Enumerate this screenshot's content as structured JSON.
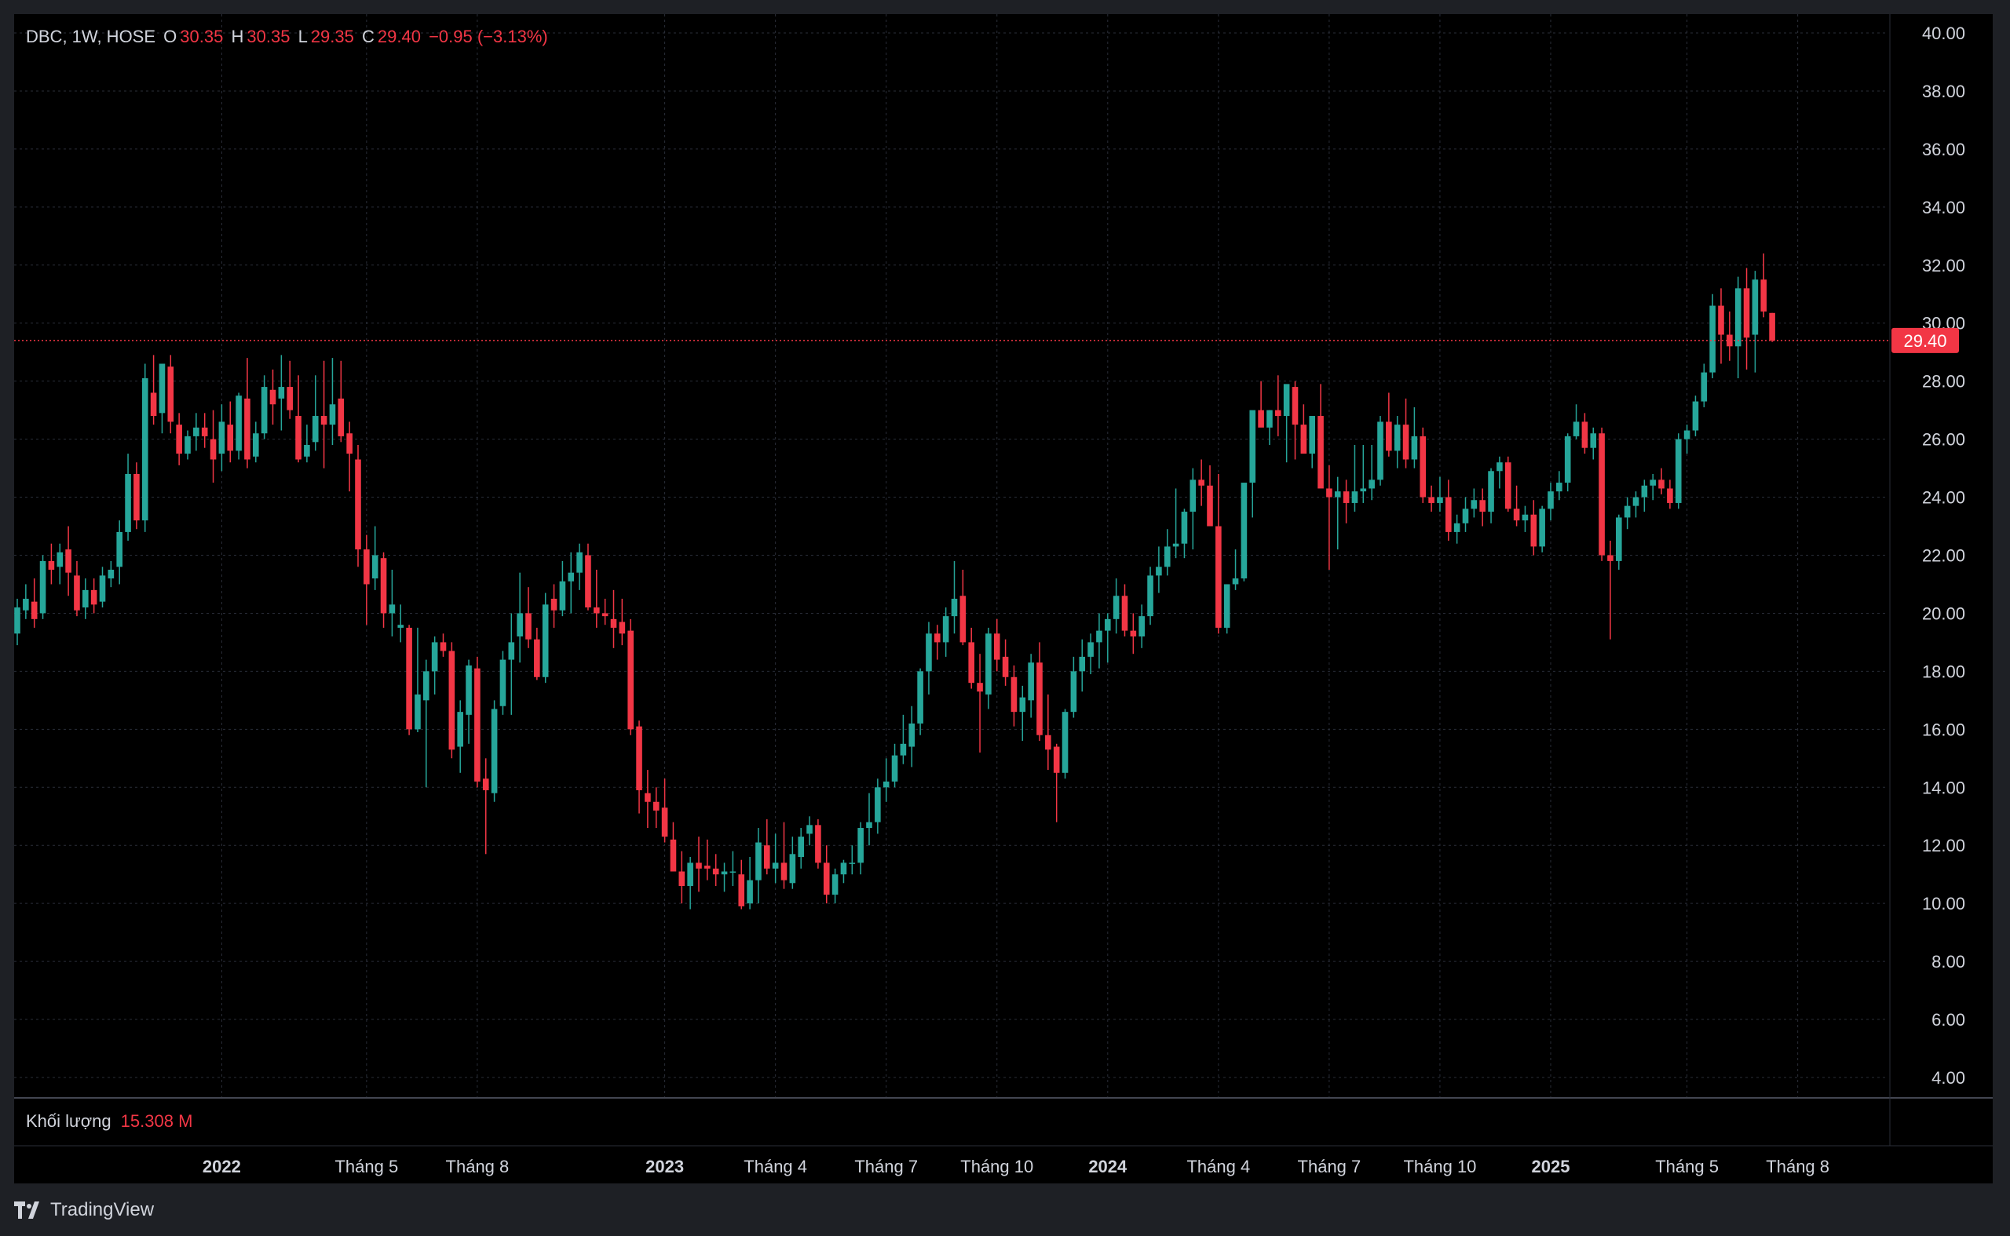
{
  "legend": {
    "symbol": "DBC, 1W, HOSE",
    "o_label": "O",
    "o_value": "30.35",
    "h_label": "H",
    "h_value": "30.35",
    "l_label": "L",
    "l_value": "29.35",
    "c_label": "C",
    "c_value": "29.40",
    "change": "−0.95 (−3.13%)"
  },
  "volume": {
    "label": "Khối lượng",
    "value": "15.308 M"
  },
  "brand": {
    "name": "TradingView"
  },
  "colors": {
    "up": "#26a69a",
    "down": "#f23645",
    "grid": "#2a2e39",
    "text": "#d1d4dc",
    "bg": "#000000"
  },
  "chart_data": {
    "type": "candlestick",
    "interval": "1W",
    "ylim": [
      3,
      41
    ],
    "y_ticks": [
      "40.00",
      "38.00",
      "36.00",
      "34.00",
      "32.00",
      "30.00",
      "28.00",
      "26.00",
      "24.00",
      "22.00",
      "20.00",
      "18.00",
      "16.00",
      "14.00",
      "12.00",
      "10.00",
      "8.00",
      "6.00",
      "4.00"
    ],
    "x_ticks": [
      {
        "label": "2022",
        "bold": true,
        "week": 24
      },
      {
        "label": "Tháng 5",
        "bold": false,
        "week": 41
      },
      {
        "label": "Tháng 8",
        "bold": false,
        "week": 54
      },
      {
        "label": "2023",
        "bold": true,
        "week": 76
      },
      {
        "label": "Tháng 4",
        "bold": false,
        "week": 89
      },
      {
        "label": "Tháng 7",
        "bold": false,
        "week": 102
      },
      {
        "label": "Tháng 10",
        "bold": false,
        "week": 115
      },
      {
        "label": "2024",
        "bold": true,
        "week": 128
      },
      {
        "label": "Tháng 4",
        "bold": false,
        "week": 141
      },
      {
        "label": "Tháng 7",
        "bold": false,
        "week": 154
      },
      {
        "label": "Tháng 10",
        "bold": false,
        "week": 167
      },
      {
        "label": "2025",
        "bold": true,
        "week": 180
      },
      {
        "label": "Tháng 5",
        "bold": false,
        "week": 196
      },
      {
        "label": "Tháng 8",
        "bold": false,
        "week": 209
      }
    ],
    "last_price": "29.40",
    "ohlc": [
      [
        19.3,
        20.5,
        18.9,
        20.2
      ],
      [
        20.1,
        21.0,
        19.8,
        20.5
      ],
      [
        20.4,
        21.2,
        19.5,
        19.8
      ],
      [
        20.0,
        22.0,
        19.8,
        21.8
      ],
      [
        21.8,
        22.4,
        21.0,
        21.5
      ],
      [
        21.6,
        22.4,
        21.0,
        22.1
      ],
      [
        22.2,
        23.0,
        20.6,
        21.4
      ],
      [
        21.3,
        21.8,
        19.9,
        20.1
      ],
      [
        20.2,
        21.2,
        19.8,
        20.8
      ],
      [
        20.8,
        21.2,
        20.0,
        20.3
      ],
      [
        20.4,
        21.6,
        20.2,
        21.3
      ],
      [
        21.2,
        21.8,
        20.9,
        21.5
      ],
      [
        21.6,
        23.2,
        21.0,
        22.8
      ],
      [
        22.8,
        25.5,
        22.5,
        24.8
      ],
      [
        24.8,
        25.2,
        22.9,
        23.2
      ],
      [
        23.2,
        28.6,
        22.8,
        28.1
      ],
      [
        27.6,
        28.9,
        26.5,
        26.8
      ],
      [
        26.9,
        28.6,
        26.2,
        28.6
      ],
      [
        28.5,
        28.9,
        26.2,
        26.6
      ],
      [
        26.5,
        26.9,
        25.1,
        25.5
      ],
      [
        25.5,
        26.3,
        25.3,
        26.1
      ],
      [
        26.1,
        26.9,
        25.6,
        26.4
      ],
      [
        26.4,
        26.9,
        25.7,
        26.1
      ],
      [
        26.0,
        27.0,
        24.5,
        25.3
      ],
      [
        25.5,
        27.2,
        24.9,
        26.6
      ],
      [
        26.5,
        27.3,
        25.2,
        25.6
      ],
      [
        25.6,
        27.6,
        25.3,
        27.5
      ],
      [
        27.4,
        28.8,
        25.0,
        25.3
      ],
      [
        25.4,
        26.6,
        25.2,
        26.2
      ],
      [
        26.2,
        28.2,
        26.0,
        27.8
      ],
      [
        27.7,
        28.4,
        26.5,
        27.2
      ],
      [
        27.4,
        28.9,
        26.3,
        27.8
      ],
      [
        27.8,
        28.7,
        26.7,
        27.0
      ],
      [
        26.8,
        28.2,
        25.2,
        25.3
      ],
      [
        25.4,
        26.5,
        25.2,
        25.8
      ],
      [
        25.9,
        28.2,
        25.6,
        26.8
      ],
      [
        26.8,
        28.7,
        25.0,
        26.5
      ],
      [
        26.5,
        28.8,
        25.8,
        27.2
      ],
      [
        27.4,
        28.7,
        25.9,
        26.1
      ],
      [
        26.2,
        26.6,
        24.2,
        25.5
      ],
      [
        25.3,
        25.8,
        21.6,
        22.2
      ],
      [
        22.2,
        22.7,
        19.6,
        21.0
      ],
      [
        21.2,
        23.0,
        20.8,
        22.0
      ],
      [
        21.9,
        22.1,
        19.5,
        20.0
      ],
      [
        20.0,
        21.5,
        19.2,
        20.3
      ],
      [
        19.5,
        20.3,
        19.0,
        19.6
      ],
      [
        19.5,
        19.6,
        15.8,
        16.0
      ],
      [
        16.0,
        19.5,
        15.9,
        17.2
      ],
      [
        17.0,
        18.4,
        14.0,
        18.0
      ],
      [
        18.0,
        19.2,
        17.2,
        19.0
      ],
      [
        19.0,
        19.3,
        18.5,
        18.7
      ],
      [
        18.7,
        19.0,
        15.0,
        15.3
      ],
      [
        15.4,
        17.0,
        14.5,
        16.6
      ],
      [
        16.5,
        18.4,
        15.5,
        18.2
      ],
      [
        18.1,
        18.5,
        14.0,
        14.2
      ],
      [
        14.3,
        15.0,
        11.7,
        13.9
      ],
      [
        13.8,
        17.0,
        13.5,
        16.7
      ],
      [
        16.8,
        18.7,
        16.5,
        18.4
      ],
      [
        18.4,
        20.0,
        16.5,
        19.0
      ],
      [
        19.2,
        21.4,
        18.3,
        20.0
      ],
      [
        20.0,
        20.9,
        18.8,
        19.1
      ],
      [
        19.1,
        19.5,
        17.7,
        17.8
      ],
      [
        17.8,
        20.7,
        17.6,
        20.3
      ],
      [
        20.5,
        21.0,
        19.5,
        20.1
      ],
      [
        20.1,
        21.8,
        19.9,
        21.1
      ],
      [
        21.1,
        22.1,
        20.0,
        21.4
      ],
      [
        21.4,
        22.4,
        20.8,
        22.1
      ],
      [
        22.0,
        22.4,
        20.1,
        20.2
      ],
      [
        20.2,
        21.5,
        19.5,
        20.0
      ],
      [
        20.0,
        20.5,
        19.6,
        19.9
      ],
      [
        19.8,
        20.8,
        18.8,
        19.5
      ],
      [
        19.7,
        20.5,
        18.9,
        19.3
      ],
      [
        19.4,
        19.8,
        15.8,
        16.0
      ],
      [
        16.1,
        16.3,
        13.1,
        13.9
      ],
      [
        13.8,
        14.6,
        12.6,
        13.5
      ],
      [
        13.5,
        14.0,
        12.6,
        13.2
      ],
      [
        13.3,
        14.3,
        12.1,
        12.3
      ],
      [
        12.2,
        12.8,
        11.5,
        11.1
      ],
      [
        11.1,
        11.8,
        10.0,
        10.6
      ],
      [
        10.6,
        11.6,
        9.8,
        11.4
      ],
      [
        11.4,
        12.3,
        10.4,
        11.2
      ],
      [
        11.3,
        12.2,
        10.8,
        11.2
      ],
      [
        11.2,
        11.7,
        10.6,
        11.0
      ],
      [
        11.0,
        11.4,
        10.4,
        11.1
      ],
      [
        11.1,
        11.8,
        10.6,
        11.1
      ],
      [
        11.0,
        11.5,
        9.8,
        9.9
      ],
      [
        10.0,
        11.6,
        9.8,
        10.8
      ],
      [
        10.8,
        12.6,
        10.0,
        12.1
      ],
      [
        12.0,
        12.9,
        11.0,
        11.2
      ],
      [
        11.2,
        12.4,
        10.7,
        11.4
      ],
      [
        11.4,
        12.8,
        10.5,
        10.8
      ],
      [
        10.7,
        12.3,
        10.5,
        11.7
      ],
      [
        11.6,
        12.6,
        11.2,
        12.3
      ],
      [
        12.4,
        13.0,
        12.0,
        12.7
      ],
      [
        12.7,
        12.9,
        11.2,
        11.4
      ],
      [
        11.4,
        12.0,
        10.0,
        10.3
      ],
      [
        10.3,
        11.2,
        10.0,
        11.0
      ],
      [
        11.0,
        11.5,
        10.7,
        11.4
      ],
      [
        11.4,
        12.0,
        11.0,
        11.4
      ],
      [
        11.4,
        12.8,
        11.0,
        12.6
      ],
      [
        12.6,
        13.8,
        12.0,
        12.8
      ],
      [
        12.8,
        14.3,
        12.4,
        14.0
      ],
      [
        14.0,
        15.0,
        13.5,
        14.2
      ],
      [
        14.2,
        15.5,
        14.0,
        15.1
      ],
      [
        15.1,
        16.5,
        14.8,
        15.5
      ],
      [
        15.4,
        16.8,
        14.7,
        16.2
      ],
      [
        16.2,
        18.1,
        15.8,
        18.0
      ],
      [
        18.0,
        19.7,
        17.2,
        19.3
      ],
      [
        19.3,
        19.6,
        18.4,
        19.0
      ],
      [
        19.0,
        20.2,
        18.5,
        19.9
      ],
      [
        19.9,
        21.8,
        19.3,
        20.5
      ],
      [
        20.6,
        21.5,
        18.9,
        19.0
      ],
      [
        19.0,
        19.5,
        17.4,
        17.6
      ],
      [
        17.6,
        18.6,
        15.2,
        17.3
      ],
      [
        17.2,
        19.5,
        16.7,
        19.3
      ],
      [
        19.3,
        19.8,
        18.0,
        18.4
      ],
      [
        18.5,
        19.1,
        17.5,
        17.8
      ],
      [
        17.8,
        18.2,
        16.1,
        16.6
      ],
      [
        16.6,
        17.5,
        15.6,
        17.1
      ],
      [
        17.0,
        18.6,
        16.4,
        18.3
      ],
      [
        18.3,
        19.0,
        15.6,
        15.8
      ],
      [
        15.8,
        17.2,
        14.6,
        15.3
      ],
      [
        15.4,
        15.5,
        12.8,
        14.5
      ],
      [
        14.5,
        16.7,
        14.3,
        16.6
      ],
      [
        16.6,
        18.5,
        16.4,
        18.0
      ],
      [
        18.0,
        19.1,
        17.3,
        18.5
      ],
      [
        18.5,
        19.3,
        17.9,
        19.0
      ],
      [
        19.0,
        20.0,
        18.1,
        19.4
      ],
      [
        19.4,
        20.0,
        18.3,
        19.8
      ],
      [
        19.8,
        21.2,
        19.3,
        20.6
      ],
      [
        20.6,
        21.0,
        19.2,
        19.4
      ],
      [
        19.4,
        20.0,
        18.6,
        19.2
      ],
      [
        19.2,
        20.3,
        18.8,
        19.9
      ],
      [
        19.9,
        21.6,
        19.6,
        21.3
      ],
      [
        21.3,
        22.3,
        20.7,
        21.6
      ],
      [
        21.6,
        22.9,
        21.3,
        22.3
      ],
      [
        22.3,
        24.3,
        21.9,
        22.4
      ],
      [
        22.4,
        23.6,
        21.9,
        23.5
      ],
      [
        23.5,
        25.0,
        22.2,
        24.6
      ],
      [
        24.6,
        25.3,
        23.7,
        24.4
      ],
      [
        24.4,
        25.1,
        23.6,
        23.0
      ],
      [
        23.0,
        24.8,
        19.3,
        19.5
      ],
      [
        19.5,
        21.0,
        19.3,
        21.0
      ],
      [
        21.0,
        22.2,
        20.8,
        21.2
      ],
      [
        21.2,
        24.3,
        21.1,
        24.5
      ],
      [
        24.5,
        25.3,
        23.3,
        27.0
      ],
      [
        27.0,
        28.0,
        26.5,
        26.4
      ],
      [
        26.4,
        27.0,
        25.8,
        27.0
      ],
      [
        27.0,
        28.2,
        26.1,
        26.8
      ],
      [
        26.8,
        27.6,
        25.2,
        27.9
      ],
      [
        27.8,
        28.0,
        25.3,
        26.5
      ],
      [
        26.5,
        27.2,
        25.8,
        25.5
      ],
      [
        25.5,
        26.3,
        25.0,
        26.8
      ],
      [
        26.8,
        27.9,
        24.5,
        24.3
      ],
      [
        24.3,
        25.1,
        21.5,
        24.0
      ],
      [
        24.0,
        24.7,
        22.2,
        24.2
      ],
      [
        24.2,
        24.6,
        23.1,
        23.8
      ],
      [
        23.8,
        25.8,
        23.5,
        24.2
      ],
      [
        24.2,
        25.8,
        23.8,
        24.3
      ],
      [
        24.3,
        25.8,
        23.9,
        24.6
      ],
      [
        24.6,
        26.8,
        24.4,
        26.6
      ],
      [
        26.6,
        27.6,
        25.4,
        25.6
      ],
      [
        25.6,
        26.8,
        25.0,
        26.5
      ],
      [
        26.5,
        27.4,
        25.0,
        25.3
      ],
      [
        25.3,
        27.1,
        25.0,
        26.1
      ],
      [
        26.1,
        26.4,
        23.8,
        24.0
      ],
      [
        24.0,
        24.4,
        23.5,
        23.8
      ],
      [
        23.8,
        24.7,
        23.5,
        24.0
      ],
      [
        24.0,
        24.6,
        22.5,
        22.8
      ],
      [
        22.8,
        23.4,
        22.4,
        23.1
      ],
      [
        23.1,
        24.0,
        22.8,
        23.6
      ],
      [
        23.6,
        24.3,
        23.3,
        23.9
      ],
      [
        23.9,
        24.3,
        23.0,
        23.5
      ],
      [
        23.5,
        25.0,
        23.1,
        24.9
      ],
      [
        24.9,
        25.4,
        24.3,
        25.2
      ],
      [
        25.2,
        25.4,
        23.5,
        23.6
      ],
      [
        23.6,
        24.4,
        23.0,
        23.2
      ],
      [
        23.2,
        23.7,
        22.8,
        23.4
      ],
      [
        23.4,
        23.9,
        22.0,
        22.3
      ],
      [
        22.3,
        23.7,
        22.1,
        23.6
      ],
      [
        23.6,
        24.5,
        23.2,
        24.2
      ],
      [
        24.2,
        24.9,
        23.9,
        24.5
      ],
      [
        24.5,
        26.2,
        24.2,
        26.1
      ],
      [
        26.1,
        27.2,
        26.0,
        26.6
      ],
      [
        26.6,
        26.9,
        25.5,
        25.7
      ],
      [
        25.7,
        26.4,
        25.3,
        26.2
      ],
      [
        26.2,
        26.4,
        21.8,
        22.0
      ],
      [
        22.0,
        22.5,
        19.1,
        21.8
      ],
      [
        21.8,
        23.4,
        21.5,
        23.3
      ],
      [
        23.3,
        24.0,
        22.9,
        23.7
      ],
      [
        23.7,
        24.2,
        23.3,
        24.0
      ],
      [
        24.0,
        24.6,
        23.5,
        24.4
      ],
      [
        24.4,
        24.8,
        23.9,
        24.6
      ],
      [
        24.6,
        25.0,
        24.1,
        24.3
      ],
      [
        24.3,
        24.6,
        23.6,
        23.8
      ],
      [
        23.8,
        26.2,
        23.6,
        26.0
      ],
      [
        26.0,
        26.5,
        25.5,
        26.3
      ],
      [
        26.3,
        27.5,
        26.1,
        27.3
      ],
      [
        27.3,
        28.6,
        27.1,
        28.3
      ],
      [
        28.3,
        31.0,
        28.1,
        30.6
      ],
      [
        30.6,
        31.2,
        28.6,
        29.6
      ],
      [
        29.6,
        30.4,
        28.7,
        29.2
      ],
      [
        29.2,
        31.6,
        28.1,
        31.2
      ],
      [
        31.2,
        31.9,
        28.4,
        29.5
      ],
      [
        29.6,
        31.8,
        28.3,
        31.5
      ],
      [
        31.5,
        32.4,
        30.2,
        30.4
      ],
      [
        30.35,
        30.35,
        29.35,
        29.4
      ]
    ]
  }
}
